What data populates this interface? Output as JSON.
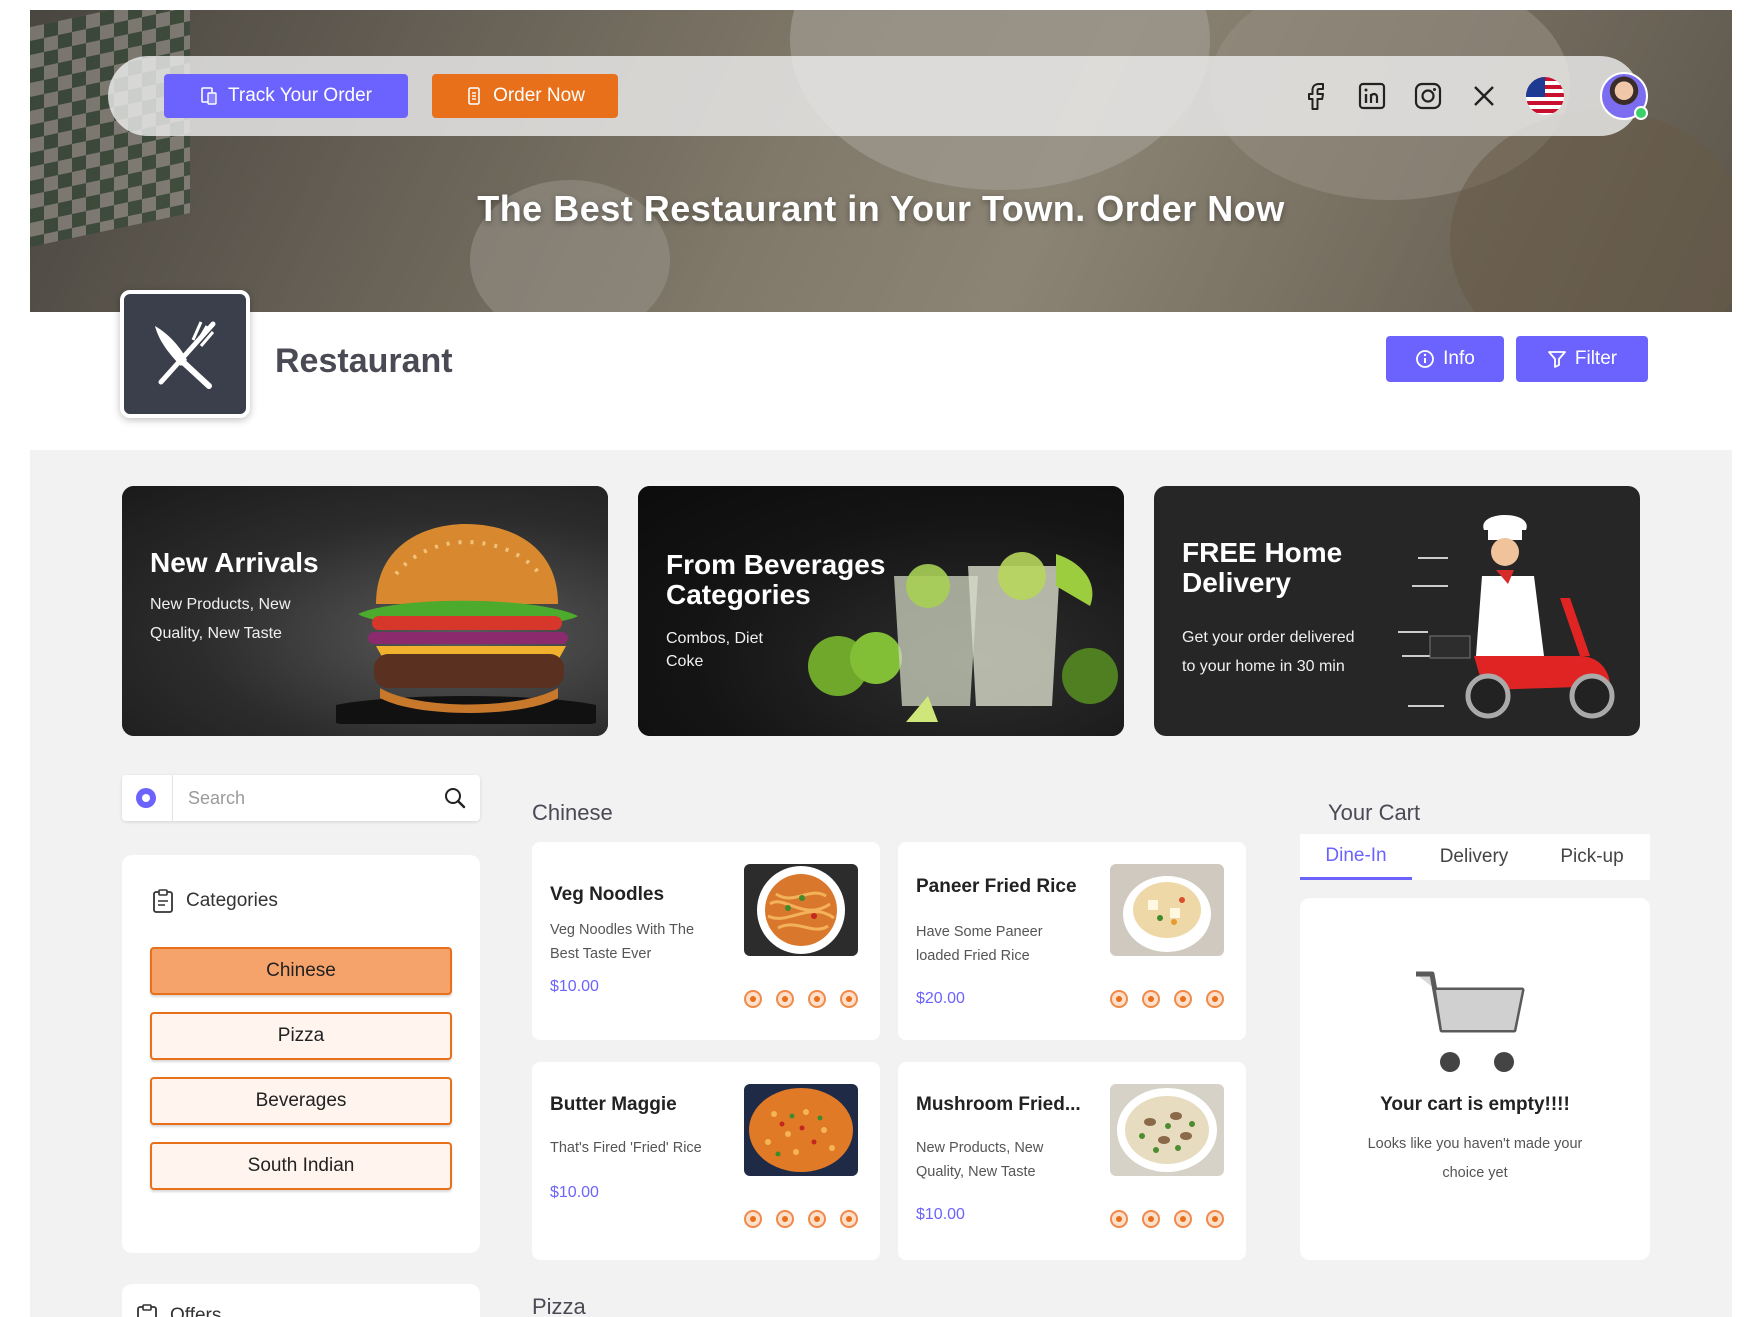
{
  "topbar": {
    "track_label": "Track Your Order",
    "order_label": "Order Now"
  },
  "hero": {
    "title": "The Best Restaurant in Your Town. Order Now"
  },
  "restaurant": {
    "name": "Restaurant",
    "info_label": "Info",
    "filter_label": "Filter"
  },
  "banners": [
    {
      "title": "New Arrivals",
      "subtitle_lines": [
        "New Products, New",
        "Quality, New Taste"
      ]
    },
    {
      "title_lines": [
        "From Beverages",
        "Categories"
      ],
      "subtitle_lines": [
        "Combos, Diet",
        "Coke"
      ]
    },
    {
      "title_lines": [
        "FREE Home",
        "Delivery"
      ],
      "subtitle_lines": [
        "Get your order delivered",
        "to your home in 30 min"
      ]
    }
  ],
  "search": {
    "placeholder": "Search"
  },
  "categories": {
    "heading": "Categories",
    "items": [
      "Chinese",
      "Pizza",
      "Beverages",
      "South Indian"
    ],
    "active": "Chinese"
  },
  "offers": {
    "heading": "Offers"
  },
  "menu": {
    "sections": [
      {
        "title": "Chinese",
        "items": [
          {
            "name": "Veg Noodles",
            "desc_lines": [
              "Veg Noodles With The",
              "Best Taste Ever"
            ],
            "price": "$10.00"
          },
          {
            "name": "Paneer Fried Rice",
            "desc_lines": [
              "Have Some Paneer",
              "loaded Fried Rice"
            ],
            "price": "$20.00"
          },
          {
            "name": "Butter Maggie",
            "desc_lines": [
              "That's Fired 'Fried' Rice"
            ],
            "price": "$10.00"
          },
          {
            "name": "Mushroom Fried...",
            "desc_lines": [
              "New Products, New",
              "Quality, New Taste"
            ],
            "price": "$10.00"
          }
        ]
      },
      {
        "title": "Pizza"
      }
    ]
  },
  "cart": {
    "title": "Your Cart",
    "tabs": [
      "Dine-In",
      "Delivery",
      "Pick-up"
    ],
    "active_tab": "Dine-In",
    "empty_title": "Your cart is empty!!!!",
    "empty_sub_lines": [
      "Looks like you haven't made your",
      "choice yet"
    ]
  },
  "colors": {
    "accent": "#6c63ff",
    "orange": "#e8701a",
    "category_active": "#f6a36b",
    "category_bg": "#fff5ee"
  },
  "icons": {
    "social": [
      "facebook-icon",
      "linkedin-icon",
      "instagram-icon",
      "x-icon",
      "us-flag-icon"
    ]
  }
}
